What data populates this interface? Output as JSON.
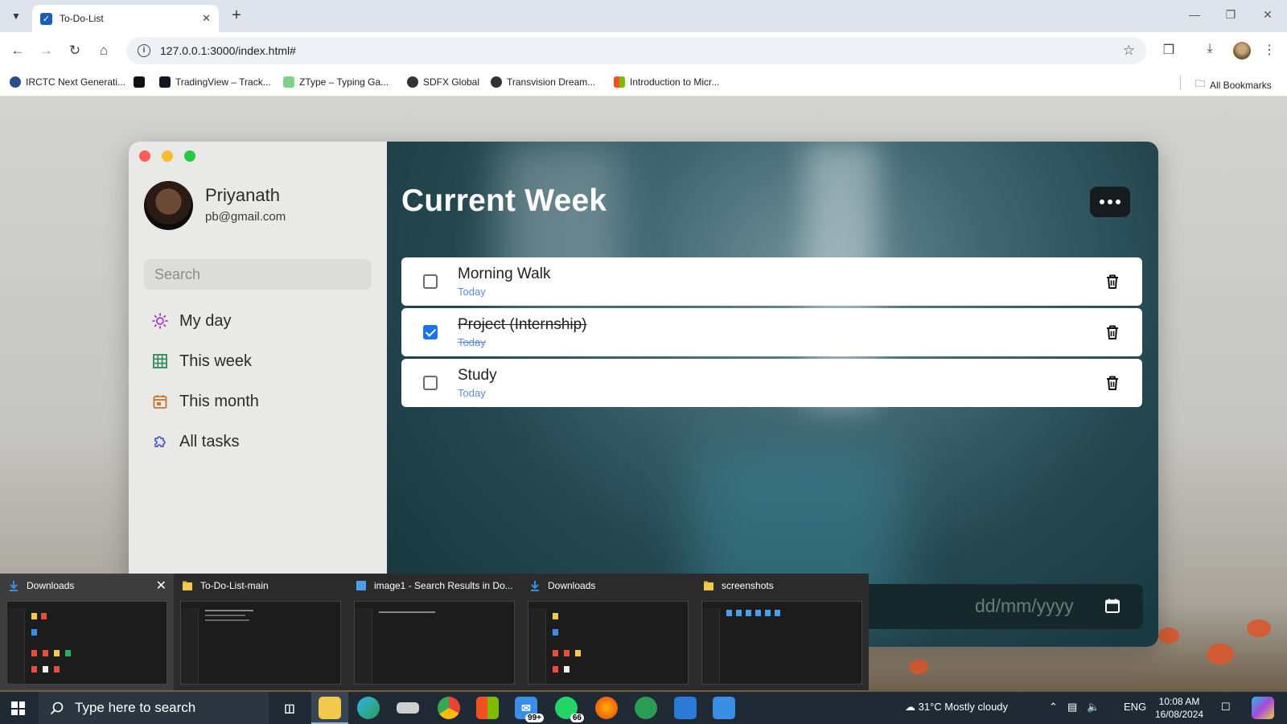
{
  "browser": {
    "tab_title": "To-Do-List",
    "url": "127.0.0.1:3000/index.html#",
    "bookmarks": [
      {
        "label": "IRCTC Next Generati...",
        "color": "#2a4b8d"
      },
      {
        "label": "",
        "color": "#111111"
      },
      {
        "label": "TradingView – Track...",
        "color": "#131722"
      },
      {
        "label": "ZType – Typing Ga...",
        "color": "#7bd389"
      },
      {
        "label": "SDFX Global",
        "color": "#333333"
      },
      {
        "label": "Transvision Dream...",
        "color": "#333333"
      },
      {
        "label": "Introduction to Micr...",
        "color": "#f25022"
      }
    ],
    "all_bookmarks_label": "All Bookmarks"
  },
  "profile": {
    "name": "Priyanath",
    "email": "pb@gmail.com"
  },
  "search": {
    "placeholder": "Search"
  },
  "nav": [
    {
      "label": "My day",
      "icon": "sun-icon",
      "color": "#a23bc7"
    },
    {
      "label": "This week",
      "icon": "calendar-grid-icon",
      "color": "#2e8b57"
    },
    {
      "label": "This month",
      "icon": "calendar-month-icon",
      "color": "#c8742a"
    },
    {
      "label": "All tasks",
      "icon": "puzzle-icon",
      "color": "#4a57c8"
    }
  ],
  "main": {
    "title": "Current Week",
    "tasks": [
      {
        "title": "Morning Walk",
        "due": "Today",
        "completed": false
      },
      {
        "title": "Project (Internship)",
        "due": "Today",
        "completed": true
      },
      {
        "title": "Study",
        "due": "Today",
        "completed": false
      }
    ],
    "date_placeholder": "dd/mm/yyyy"
  },
  "taskbar_previews": [
    {
      "label": "Downloads",
      "icon": "download-icon",
      "color": "#3a8ee6"
    },
    {
      "label": "To-Do-List-main",
      "icon": "folder-icon",
      "color": "#f2c94c"
    },
    {
      "label": "image1 - Search Results in Do...",
      "icon": "search-results-icon",
      "color": "#4a9fe6"
    },
    {
      "label": "Downloads",
      "icon": "download-icon",
      "color": "#3a8ee6"
    },
    {
      "label": "screenshots",
      "icon": "folder-icon",
      "color": "#f2c94c"
    }
  ],
  "taskbar": {
    "search_placeholder": "Type here to search",
    "mail_badge": "99+",
    "whatsapp_badge": "66",
    "weather": "31°C  Mostly cloudy",
    "language": "ENG",
    "time": "10:08 AM",
    "date": "16/08/2024"
  }
}
